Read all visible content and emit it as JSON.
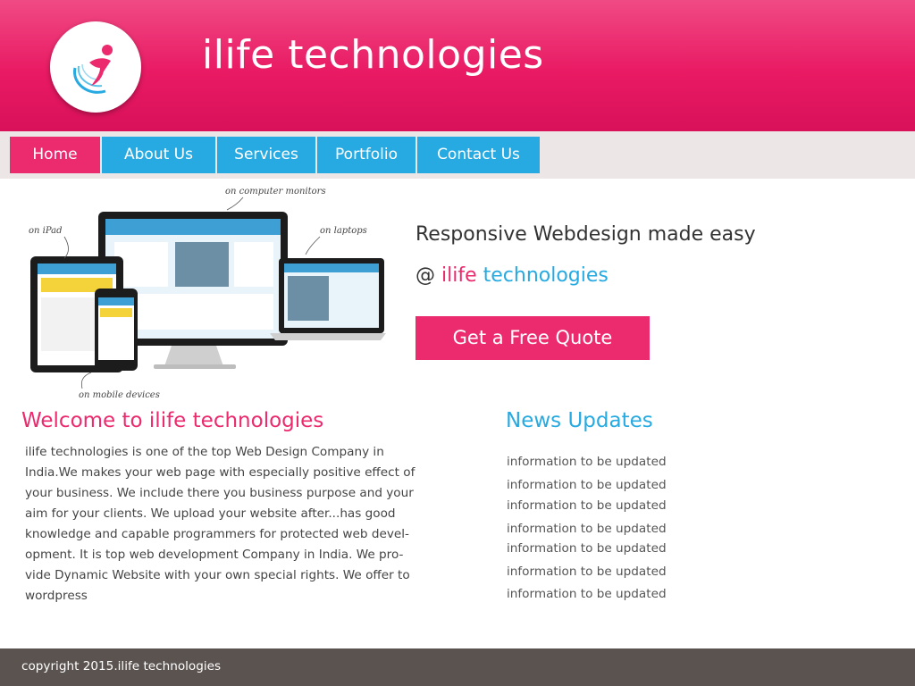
{
  "header": {
    "site_title": "ilife technologies",
    "logo_icon": "ilife-logo-icon"
  },
  "nav": {
    "items": [
      {
        "label": "Home",
        "active": true
      },
      {
        "label": "About Us",
        "active": false
      },
      {
        "label": "Services",
        "active": false
      },
      {
        "label": "Portfolio",
        "active": false
      },
      {
        "label": "Contact  Us",
        "active": false
      }
    ]
  },
  "hero": {
    "image_notes": [
      "on computer monitors",
      "on iPad",
      "on laptops",
      "on mobile devices"
    ],
    "tagline": "Responsive Webdesign made easy",
    "tagline2_prefix": "@ ",
    "tagline2_brand_pink": "ilife",
    "tagline2_brand_blue": " technologies",
    "cta_label": "Get a Free Quote"
  },
  "welcome": {
    "title": "Welcome to ilife technologies",
    "body": "ilife technologies is one of the top Web Design Company in India.We makes your web page with especially positive effect of your business. We include there you business purpose and your aim for your clients. We upload your website after...has good knowledge and capable programmers for protected web devel-opment. It is top web development Company in India. We pro-vide Dynamic Website with your own special rights. We offer to wordpress"
  },
  "news": {
    "title": "News Updates",
    "items": [
      "information to be updated",
      "information to be updated",
      "information to be updated",
      "information to be updated",
      "information to be updated",
      "information to be updated",
      "information to be updated"
    ]
  },
  "footer": {
    "copyright": "copyright 2015.ilife technologies"
  },
  "colors": {
    "brand_pink": "#ec2a6e",
    "brand_blue": "#27aae1",
    "footer_bg": "#5a5350",
    "nav_bg": "#ece6e6"
  }
}
